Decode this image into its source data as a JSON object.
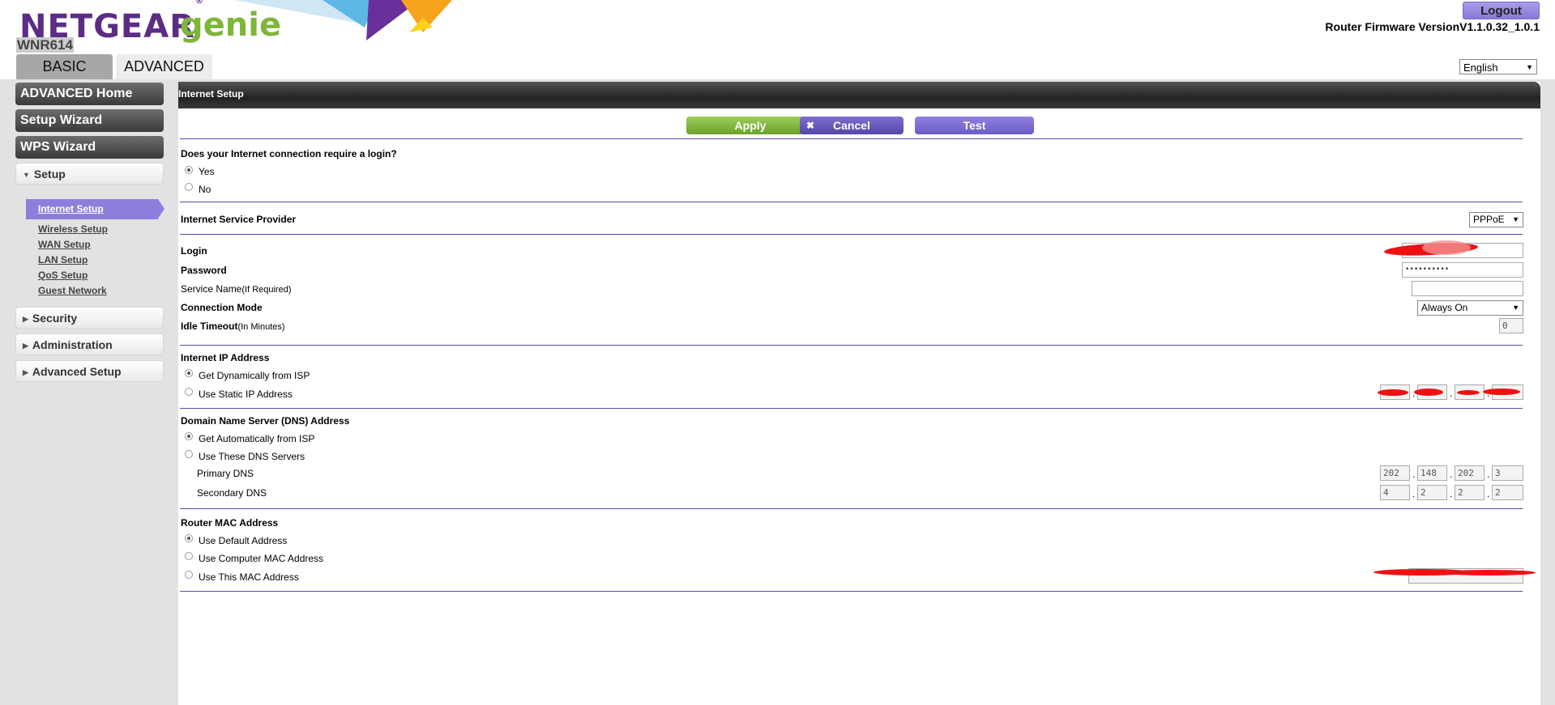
{
  "header": {
    "brand": "NETGEAR",
    "brand_reg": "®",
    "product": "genie",
    "model": "WNR614",
    "logout_label": "Logout",
    "firmware_label": "Router Firmware Version",
    "firmware_version": "V1.1.0.32_1.0.1",
    "tabs": [
      {
        "label": "BASIC",
        "active": false
      },
      {
        "label": "ADVANCED",
        "active": true
      }
    ],
    "language": "English"
  },
  "sidebar": {
    "main_buttons": [
      "ADVANCED Home",
      "Setup Wizard",
      "WPS Wizard"
    ],
    "setup_section": "Setup",
    "setup_items": [
      "Internet Setup",
      "Wireless Setup",
      "WAN Setup",
      "LAN Setup",
      "QoS Setup",
      "Guest Network"
    ],
    "active_item": "Internet Setup",
    "sections": [
      "Security",
      "Administration",
      "Advanced Setup"
    ]
  },
  "main": {
    "title": "Internet Setup",
    "buttons": {
      "apply": "Apply",
      "cancel": "Cancel",
      "test": "Test"
    },
    "login_question": "Does your Internet connection require a login?",
    "login_options": [
      {
        "label": "Yes",
        "checked": true
      },
      {
        "label": "No",
        "checked": false
      }
    ],
    "isp_label": "Internet Service Provider",
    "isp_value": "PPPoE",
    "login_label": "Login",
    "password_label": "Password",
    "password_value": "••••••••••",
    "service_name_label": "Service Name",
    "service_name_hint": "(If Required)",
    "connection_mode_label": "Connection Mode",
    "connection_mode_value": "Always On",
    "idle_timeout_label": "Idle Timeout",
    "idle_timeout_hint": "(In Minutes)",
    "idle_timeout_value": "0",
    "ip_section_label": "Internet IP Address",
    "ip_options": [
      {
        "label": "Get Dynamically from ISP",
        "checked": true
      },
      {
        "label": "Use Static IP Address",
        "checked": false
      }
    ],
    "dns_section_label": "Domain Name Server (DNS) Address",
    "dns_options": [
      {
        "label": "Get Automatically from ISP",
        "checked": true
      },
      {
        "label": "Use These DNS Servers",
        "checked": false
      }
    ],
    "primary_dns_label": "Primary DNS",
    "primary_dns": [
      "202",
      "148",
      "202",
      "3"
    ],
    "secondary_dns_label": "Secondary DNS",
    "secondary_dns": [
      "4",
      "2",
      "2",
      "2"
    ],
    "mac_section_label": "Router MAC Address",
    "mac_options": [
      {
        "label": "Use Default Address",
        "checked": true
      },
      {
        "label": "Use Computer MAC Address",
        "checked": false
      },
      {
        "label": "Use This MAC Address",
        "checked": false
      }
    ]
  },
  "colors": {
    "brand_purple": "#5b2c86",
    "genie_green": "#7fb539",
    "accent_purple": "#8c7fdc",
    "apply_green": "#7fb539",
    "redaction_red": "#ee1111"
  }
}
